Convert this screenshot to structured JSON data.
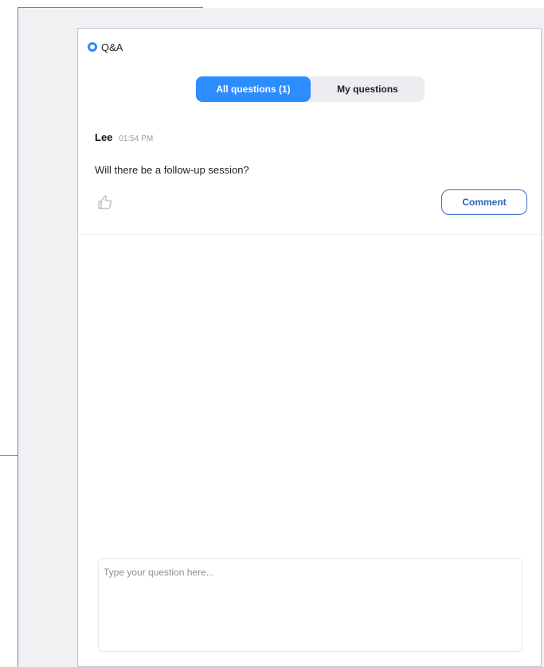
{
  "panel": {
    "title": "Q&A",
    "tabs": [
      {
        "label": "All questions (1)",
        "active": true
      },
      {
        "label": "My questions",
        "active": false
      }
    ]
  },
  "questions": [
    {
      "author": "Lee",
      "time": "01:54 PM",
      "text": "Will there be a follow-up session?",
      "comment_label": "Comment"
    }
  ],
  "input": {
    "placeholder": "Type your question here...",
    "value": ""
  },
  "colors": {
    "accent": "#2d8cff",
    "comment_border": "#3a6fc1"
  },
  "icons": {
    "header": "qa-circle-icon",
    "like": "thumbs-up-icon"
  }
}
